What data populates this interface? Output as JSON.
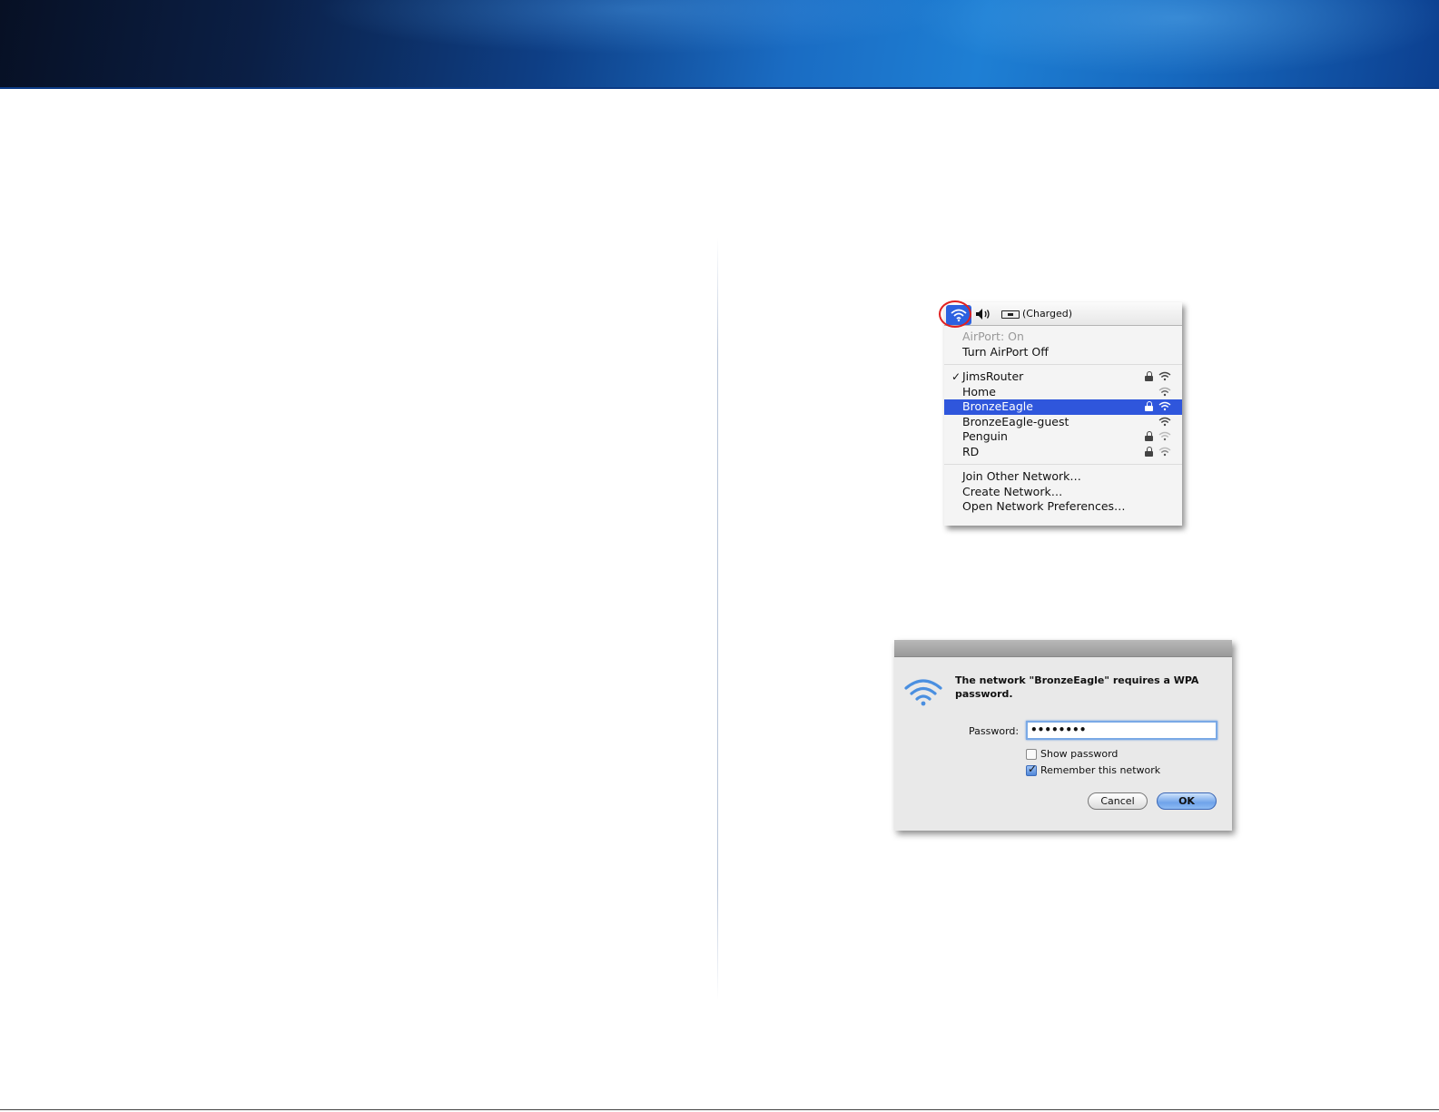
{
  "airport_menu": {
    "battery_status": "(Charged)",
    "items_top": [
      {
        "label": "AirPort: On",
        "dim": true
      },
      {
        "label": "Turn AirPort Off",
        "dim": false
      }
    ],
    "networks": [
      {
        "name": "JimsRouter",
        "checked": true,
        "locked": true,
        "selected": false
      },
      {
        "name": "Home",
        "checked": false,
        "locked": false,
        "selected": false
      },
      {
        "name": "BronzeEagle",
        "checked": false,
        "locked": true,
        "selected": true
      },
      {
        "name": "BronzeEagle-guest",
        "checked": false,
        "locked": false,
        "selected": false
      },
      {
        "name": "Penguin",
        "checked": false,
        "locked": true,
        "selected": false
      },
      {
        "name": "RD",
        "checked": false,
        "locked": true,
        "selected": false
      }
    ],
    "items_bottom": [
      {
        "label": "Join Other Network…"
      },
      {
        "label": "Create Network…"
      },
      {
        "label": "Open Network Preferences…"
      }
    ],
    "check_mark": "✓"
  },
  "password_dialog": {
    "message": "The network \"BronzeEagle\" requires a WPA password.",
    "password_label": "Password:",
    "password_value": "••••••••",
    "show_password_label": "Show password",
    "show_password_checked": false,
    "remember_label": "Remember this network",
    "remember_checked": true,
    "cancel_label": "Cancel",
    "ok_label": "OK"
  },
  "colors": {
    "menu_selection": "#2f56dc",
    "wifi_highlight": "#2c61e0",
    "callout_ring": "#e02020",
    "banner_blue": "#1a6cc3"
  }
}
